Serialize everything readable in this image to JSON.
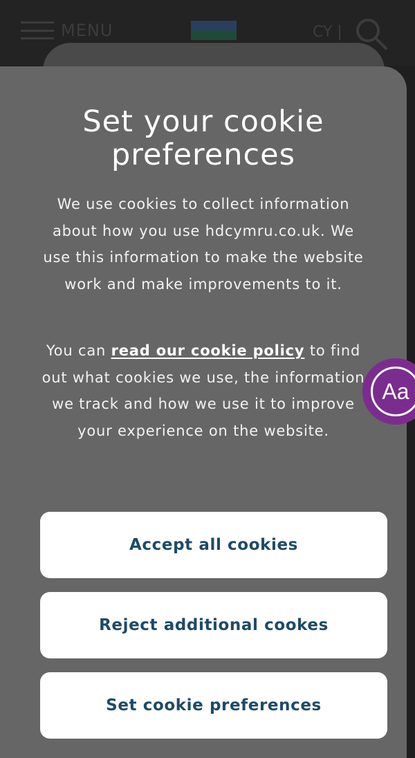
{
  "header": {
    "menu_label": "MENU",
    "lang_label": "CY |"
  },
  "modal": {
    "title": "Set your cookie preferences",
    "paragraph1": "We use cookies to collect information about how you use hdcymru.co.uk. We use this information to make the website work and make improvements to it.",
    "paragraph2_before": "You can ",
    "paragraph2_link": "read our cookie policy",
    "paragraph2_after": " to find out what cookies we use, the information we track and how we use it to improve your experience on the website.",
    "buttons": {
      "accept": "Accept all cookies",
      "reject": "Reject additional cookes",
      "preferences": "Set cookie preferences"
    }
  },
  "accessibility": {
    "label": "Aa"
  },
  "colors": {
    "modal_bg": "#666666",
    "button_text": "#1e4a66",
    "accessibility_bg": "#7a2d8f"
  }
}
